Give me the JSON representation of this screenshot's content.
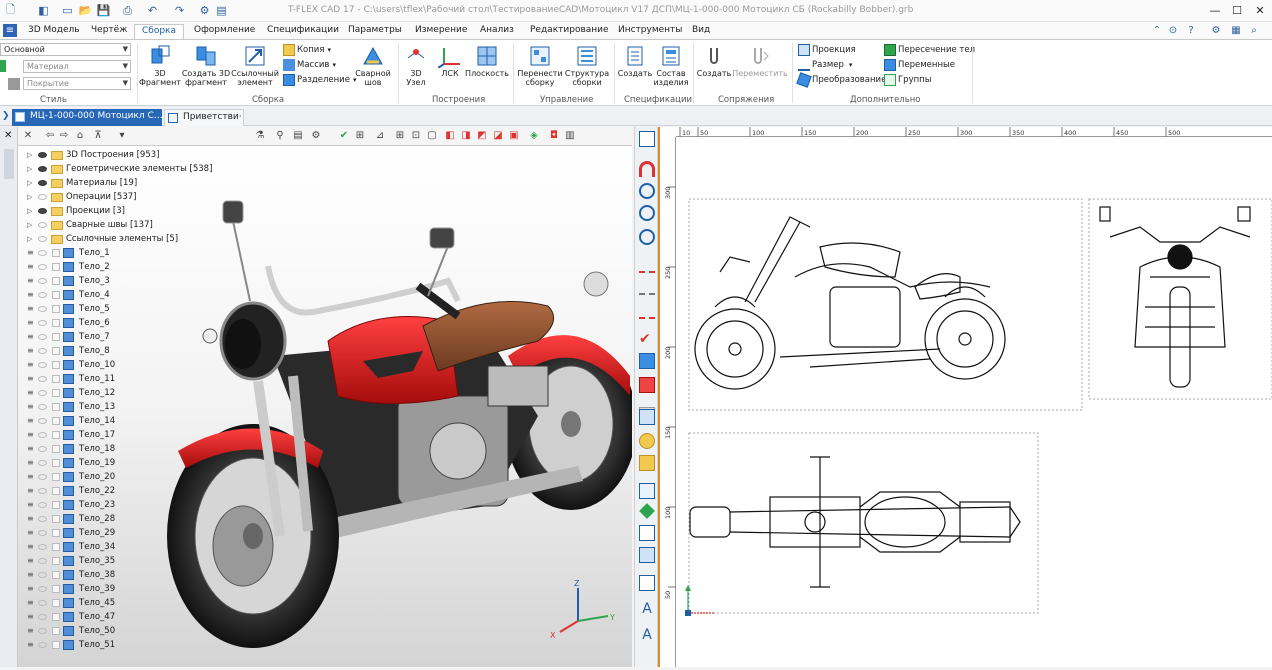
{
  "window": {
    "title": "T-FLEX CAD 17 - C:\\users\\tflex\\Рабочий стол\\ТестированиеCAD\\Мотоцикл V17 ДСП\\МЦ-1-000-000 Мотоцикл СБ (Rockabilly Bobber).grb"
  },
  "menu": {
    "tabs": [
      "3D Модель",
      "Чертёж",
      "Сборка",
      "Оформление",
      "Спецификации",
      "Параметры",
      "Измерение",
      "Анализ",
      "Редактирование",
      "Инструменты",
      "Вид"
    ],
    "active": "Сборка"
  },
  "ribbon": {
    "style_group": {
      "label": "Стиль",
      "layer_value": "Основной",
      "material_placeholder": "Материал",
      "coating_placeholder": "Покрытие"
    },
    "assembly_group": {
      "label": "Сборка",
      "btn_3d_fragment": "3D\nФрагмент",
      "btn_create_3d_fragment": "Создать 3D\nфрагмент",
      "btn_ref_element": "Ссылочный\nэлемент",
      "copy": "Копия",
      "array": "Массив",
      "split": "Разделение",
      "weld": "Сварной\nшов"
    },
    "construct_group": {
      "label": "Построения",
      "node": "3D\nУзел",
      "lsk": "ЛСК",
      "plane": "Плоскость"
    },
    "control_group": {
      "label": "Управление",
      "move_assembly": "Перенести\nсборку",
      "structure": "Структура\nсборки"
    },
    "spec_group": {
      "label": "Спецификации",
      "create": "Создать",
      "product_content": "Состав\nизделия"
    },
    "mate_group": {
      "label": "Сопряжения",
      "create": "Создать",
      "move": "Переместить"
    },
    "extra_group": {
      "label": "Дополнительно",
      "projection": "Проекция",
      "size": "Размер",
      "transform": "Преобразование",
      "intersection": "Пересечение тел",
      "variables": "Переменные",
      "groups": "Группы"
    }
  },
  "doc_tabs": [
    {
      "label": "МЦ-1-000-000 Мотоцикл С…",
      "active": true
    },
    {
      "label": "Приветстви·",
      "active": false
    }
  ],
  "tree": {
    "folders": [
      {
        "label": "3D Построения [953]",
        "eye": true
      },
      {
        "label": "Геометрические элементы [538]",
        "eye": true
      },
      {
        "label": "Материалы [19]",
        "eye": true
      },
      {
        "label": "Операции [537]",
        "eye": false
      },
      {
        "label": "Проекции [3]",
        "eye": true
      },
      {
        "label": "Сварные швы [137]",
        "eye": false
      },
      {
        "label": "Ссылочные элементы [5]",
        "eye": false
      }
    ],
    "bodies": [
      "Тело_1",
      "Тело_2",
      "Тело_3",
      "Тело_4",
      "Тело_5",
      "Тело_6",
      "Тело_7",
      "Тело_8",
      "Тело_10",
      "Тело_11",
      "Тело_12",
      "Тело_13",
      "Тело_14",
      "Тело_17",
      "Тело_18",
      "Тело_19",
      "Тело_20",
      "Тело_22",
      "Тело_23",
      "Тело_28",
      "Тело_29",
      "Тело_34",
      "Тело_35",
      "Тело_38",
      "Тело_39",
      "Тело_45",
      "Тело_47",
      "Тело_50",
      "Тело_51"
    ]
  },
  "viewport": {
    "axes": [
      "X",
      "Y",
      "Z"
    ]
  },
  "ruler": {
    "top_ticks": [
      "10",
      "50",
      "100",
      "150",
      "200",
      "250",
      "300",
      "350",
      "400",
      "450",
      "500"
    ],
    "left_ticks": [
      "300",
      "250",
      "200",
      "150",
      "100",
      "50"
    ]
  },
  "colors": {
    "accent": "#1e5fa8",
    "tank_red": "#d81818",
    "seat_brown": "#8a4a2a",
    "folder": "#f5cf61",
    "body_icon": "#4f8fd8",
    "orange_divider": "#e08a2a"
  }
}
